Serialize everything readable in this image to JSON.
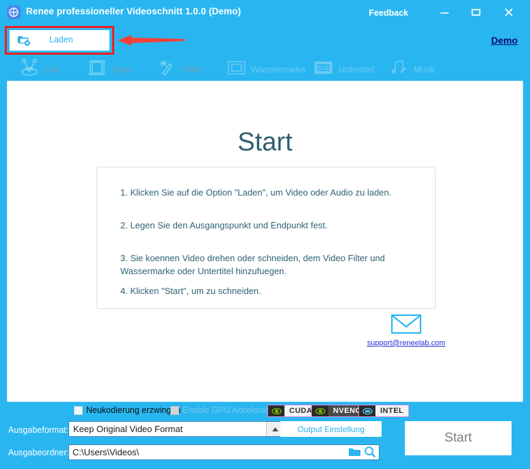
{
  "window": {
    "title": "Renee professioneller Videoschnitt 1.0.0 (Demo)",
    "app_icon": "film-reel-icon",
    "feedback": "Feedback",
    "minimize": "minimize-icon",
    "maximize": "maximize-icon",
    "close": "close-icon",
    "accent_color": "#29b6f0"
  },
  "loadbar": {
    "laden_label": "Laden",
    "laden_icon": "add-folder-icon",
    "demo_label": "Demo",
    "highlight_color": "#f01e1e",
    "arrow_color": "#f2423a"
  },
  "toolbar": {
    "items": [
      {
        "label": "Cut",
        "icon": "scissors-icon"
      },
      {
        "label": "Crop",
        "icon": "crop-film-icon"
      },
      {
        "label": "Filter",
        "icon": "magic-wand-icon"
      },
      {
        "label": "Wassermarke",
        "icon": "watermark-frame-icon"
      },
      {
        "label": "Untertitel",
        "icon": "sub-film-icon"
      },
      {
        "label": "Musk",
        "icon": "music-note-pencil-icon"
      }
    ]
  },
  "main": {
    "title": "Start",
    "instructions": [
      "1. Klicken Sie auf die Option \"Laden\", um Video oder Audio zu laden.",
      "2. Legen Sie den Ausgangspunkt und Endpunkt fest.",
      "3. Sie koennen Video drehen oder schneiden, dem Video Filter und Wassermarke oder Untertitel hinzufuegen.",
      "4. Klicken \"Start\", um zu schneiden."
    ],
    "support_email": "support@reneelab.com",
    "mail_icon": "envelope-icon"
  },
  "bottom": {
    "recode_label": "Neukodierung erzwingen",
    "recode_checked": false,
    "gpu_label": "Enable GPU Acceleration",
    "gpu_checked": false,
    "gpu_badges": [
      {
        "name": "CUDA",
        "icon": "nvidia-eye-icon"
      },
      {
        "name": "NVENC",
        "icon": "nvidia-eye-icon"
      },
      {
        "name": "INTEL",
        "icon": "intel-chip-icon"
      }
    ],
    "format_label": "Ausgabeformat:",
    "format_value": "Keep Original Video Format",
    "format_arrow": "chevron-up-icon",
    "output_settings_label": "Output Einstellung",
    "folder_label": "Ausgabeordner:",
    "folder_value": "C:\\Users\\Videos\\",
    "folder_icon": "folder-icon",
    "search_icon": "magnifier-icon",
    "start_label": "Start"
  }
}
